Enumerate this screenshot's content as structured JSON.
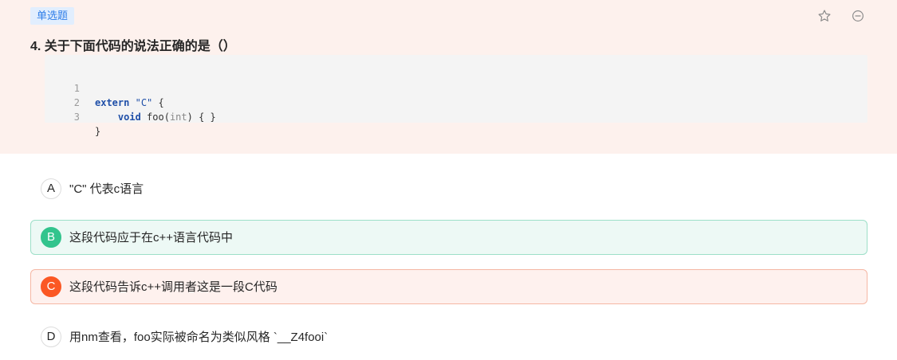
{
  "question": {
    "tag": "单选题",
    "title": "4. 关于下面代码的说法正确的是（）",
    "code_lines": [
      {
        "num": "1",
        "parts": [
          {
            "t": "extern",
            "c": "kw"
          },
          {
            "t": " "
          },
          {
            "t": "\"C\"",
            "c": "str"
          },
          {
            "t": " {"
          }
        ]
      },
      {
        "num": "2",
        "parts": [
          {
            "t": "    "
          },
          {
            "t": "void",
            "c": "kw"
          },
          {
            "t": " foo("
          },
          {
            "t": "int",
            "c": "ty"
          },
          {
            "t": ") { }"
          }
        ]
      },
      {
        "num": "3",
        "parts": [
          {
            "t": "}"
          }
        ]
      }
    ]
  },
  "options": [
    {
      "letter": "A",
      "text": "\"C\" 代表c语言",
      "state": "default"
    },
    {
      "letter": "B",
      "text": "这段代码应于在c++语言代码中",
      "state": "correct"
    },
    {
      "letter": "C",
      "text": "这段代码告诉c++调用者这是一段C代码",
      "state": "wrong"
    },
    {
      "letter": "D",
      "text": "用nm查看，foo实际被命名为类似风格 `__Z4fooi`",
      "state": "default"
    }
  ],
  "icons": {
    "favorite": "star-outline-icon",
    "remove": "minus-circle-icon"
  },
  "colors": {
    "question_bg": "#fdf1ed",
    "tag_bg": "#e1eefe",
    "tag_text": "#2f7ee8",
    "correct": "#32c48d",
    "wrong": "#fb5824"
  }
}
